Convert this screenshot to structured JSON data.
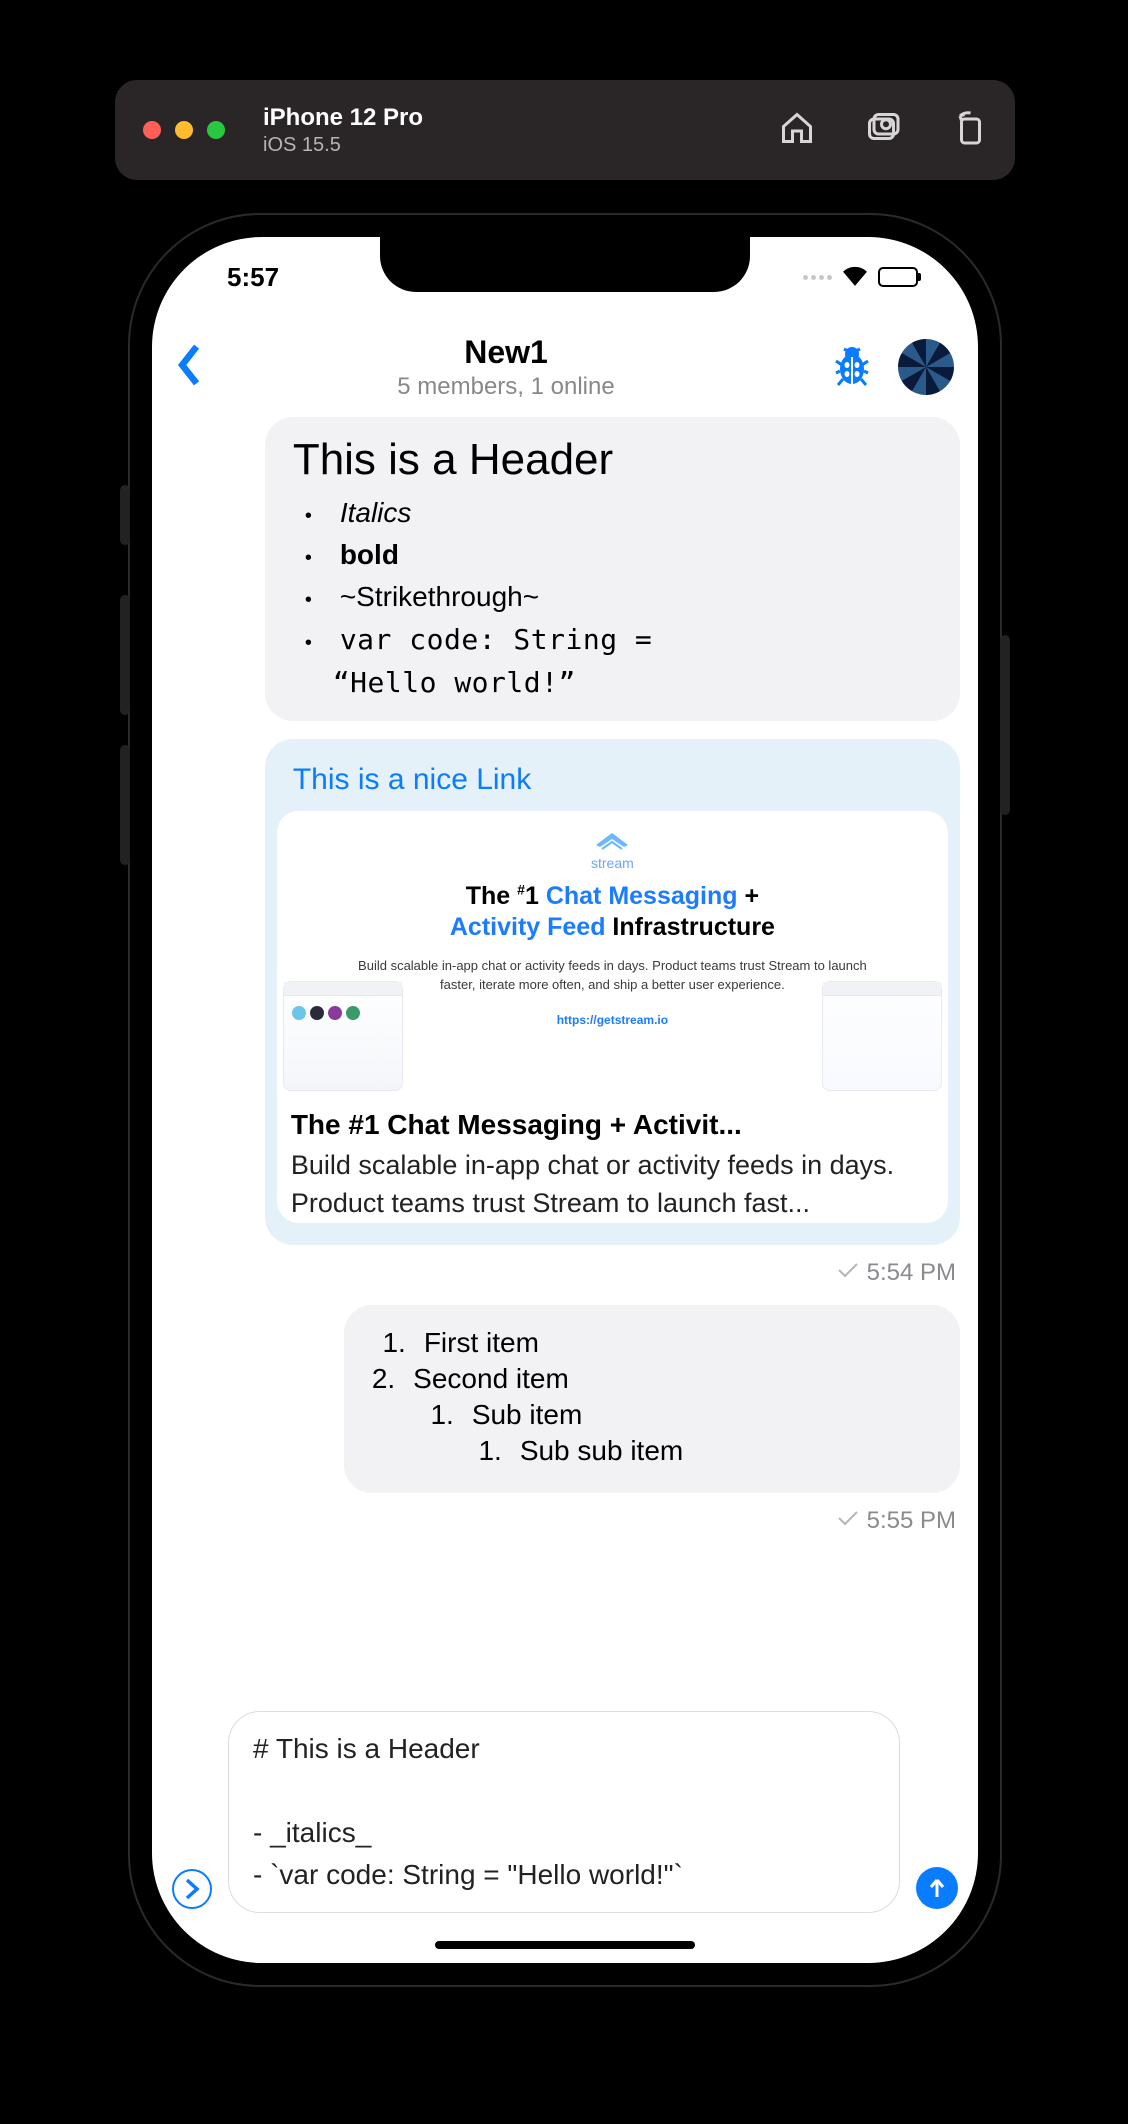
{
  "xcode": {
    "device": "iPhone 12 Pro",
    "os": "iOS 15.5"
  },
  "status": {
    "time": "5:57"
  },
  "header": {
    "title": "New1",
    "subtitle": "5 members, 1 online"
  },
  "msg1": {
    "header": "This is a Header",
    "items": {
      "italic": "Italics",
      "bold": "bold",
      "strike": "~Strikethrough~",
      "code1": "var code: String =",
      "code2": "“Hello world!”"
    }
  },
  "msg2": {
    "link_text": "This is a nice Link",
    "hero": {
      "brand": "stream",
      "title_prefix": "The ",
      "title_num": "#1 ",
      "title_blue1": "Chat Messaging",
      "title_plus": " +",
      "title_blue2": "Activity Feed",
      "title_suffix": " Infrastructure",
      "sub": "Build scalable in-app chat or activity feeds in days. Product teams trust Stream to launch faster, iterate more often, and ship a better user experience.",
      "url": "https://getstream.io"
    },
    "preview_title": "The #1 Chat Messaging + Activit...",
    "preview_desc": "Build scalable in-app chat or activity feeds in days. Product teams trust Stream to launch fast..."
  },
  "ts1": "5:54 PM",
  "msg3": {
    "i1_idx": "1.",
    "i1": "First item",
    "i2_idx": "2.",
    "i2": "Second item",
    "s1_idx": "1.",
    "s1": "Sub item",
    "ss1_idx": "1.",
    "ss1": "Sub sub item"
  },
  "ts2": "5:55 PM",
  "composer": {
    "value": "# This is a Header\n\n- _italics_\n- `var code: String = \"Hello world!\"`"
  }
}
